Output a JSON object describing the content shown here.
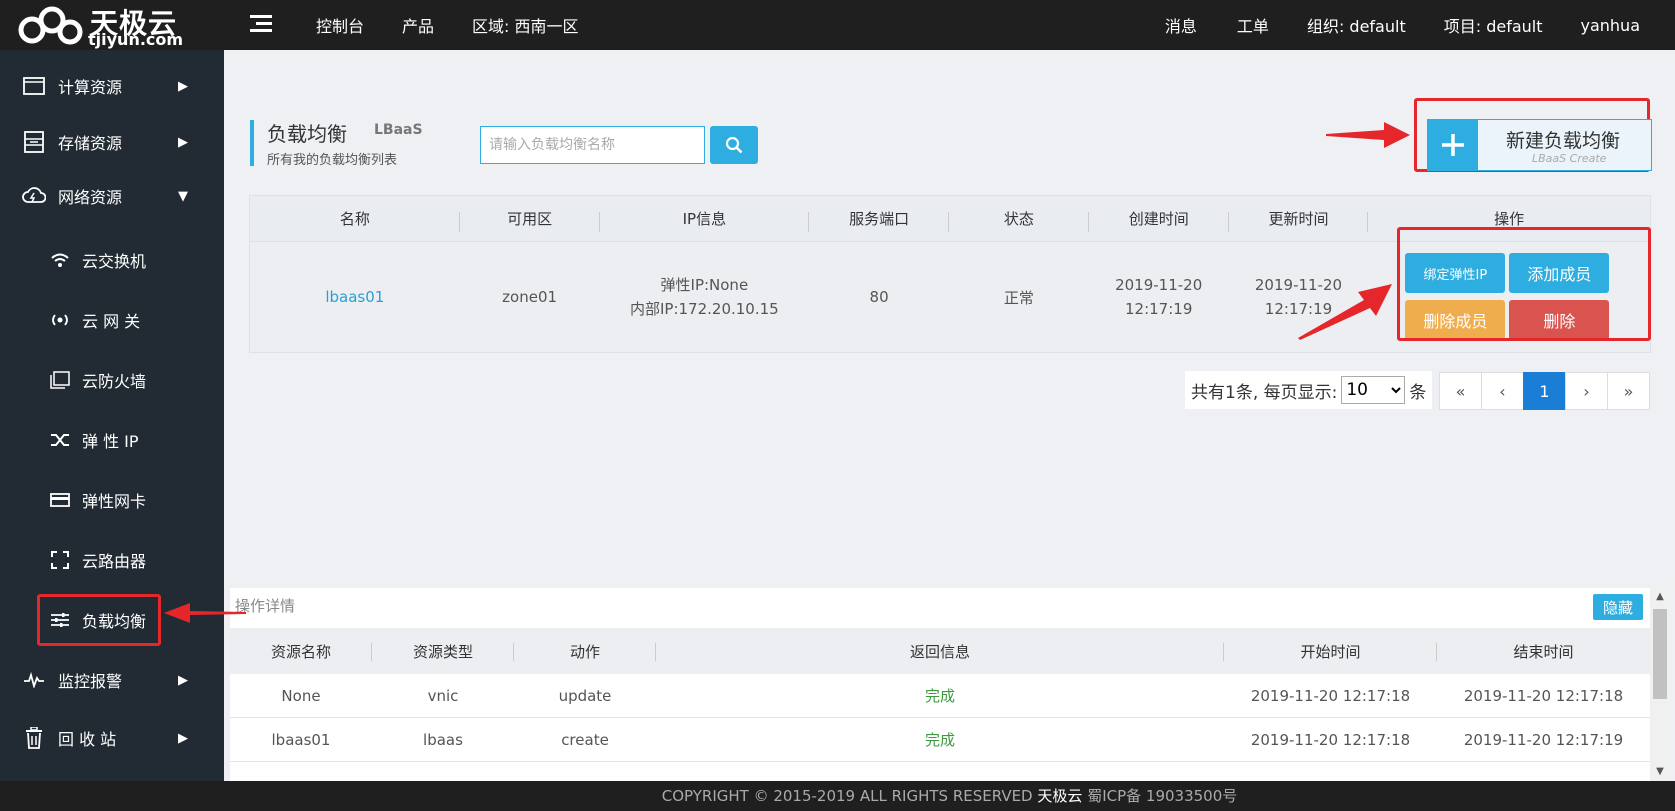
{
  "header": {
    "brand": "天极云",
    "domain": "tjiyun.com",
    "nav_left": [
      "控制台",
      "产品",
      "区域: 西南一区"
    ],
    "messages": "消息",
    "ticket": "工单",
    "org": "组织: default",
    "project": "项目: default",
    "user": "yanhua"
  },
  "sidebar": {
    "items": [
      {
        "label": "计算资源",
        "icon": "monitor-icon",
        "arrow": "▶"
      },
      {
        "label": "存储资源",
        "icon": "storage-icon",
        "arrow": "▶"
      },
      {
        "label": "网络资源",
        "icon": "cloud-lightning-icon",
        "arrow": "▼"
      },
      {
        "label": "云交换机",
        "icon": "wifi-icon"
      },
      {
        "label": "云 网 关",
        "icon": "broadcast-icon"
      },
      {
        "label": "云防火墙",
        "icon": "window-icon"
      },
      {
        "label": "弹 性 IP",
        "icon": "shuffle-icon"
      },
      {
        "label": "弹性网卡",
        "icon": "card-icon"
      },
      {
        "label": "云路由器",
        "icon": "expand-icon"
      },
      {
        "label": "负载均衡",
        "icon": "sliders-icon"
      },
      {
        "label": "监控报警",
        "icon": "pulse-icon",
        "arrow": "▶"
      },
      {
        "label": "回 收 站",
        "icon": "trash-icon",
        "arrow": "▶"
      }
    ]
  },
  "page": {
    "title": "负载均衡",
    "subtitle": "LBaaS",
    "description": "所有我的负载均衡列表",
    "search_placeholder": "请输入负载均衡名称",
    "create_label": "新建负载均衡",
    "create_sub": "LBaaS Create"
  },
  "lb_table": {
    "headers": [
      "名称",
      "可用区",
      "IP信息",
      "服务端口",
      "状态",
      "创建时间",
      "更新时间",
      "操作"
    ],
    "rows": [
      {
        "name": "lbaas01",
        "zone": "zone01",
        "ip_line1": "弹性IP:None",
        "ip_line2": "内部IP:172.20.10.15",
        "port": "80",
        "status": "正常",
        "created_date": "2019-11-20",
        "created_time": "12:17:19",
        "updated_date": "2019-11-20",
        "updated_time": "12:17:19"
      }
    ],
    "actions": {
      "bind": "绑定弹性IP",
      "add": "添加成员",
      "remove_member": "删除成员",
      "delete": "删除"
    }
  },
  "pagination": {
    "total_text": "共有1条, 每页显示:",
    "page_size": "10",
    "unit": "条",
    "first": "«",
    "prev": "‹",
    "current": "1",
    "next": "›",
    "last": "»"
  },
  "details": {
    "title": "操作详情",
    "hide_label": "隐藏",
    "headers": [
      "资源名称",
      "资源类型",
      "动作",
      "返回信息",
      "开始时间",
      "结束时间"
    ],
    "rows": [
      {
        "name": "None",
        "type": "vnic",
        "action": "update",
        "result": "完成",
        "start": "2019-11-20 12:17:18",
        "end": "2019-11-20 12:17:18"
      },
      {
        "name": "lbaas01",
        "type": "lbaas",
        "action": "create",
        "result": "完成",
        "start": "2019-11-20 12:17:18",
        "end": "2019-11-20 12:17:19"
      }
    ]
  },
  "footer": {
    "copyright": "COPYRIGHT © 2015-2019 ALL RIGHTS RESERVED",
    "brand": "天极云",
    "icp": "蜀ICP备 19033500号"
  },
  "colors": {
    "accent": "#2eaee0",
    "warning": "#f0ad4e",
    "danger": "#d9534f",
    "annotation": "#e5262b",
    "sidebar_bg": "#222b33"
  }
}
